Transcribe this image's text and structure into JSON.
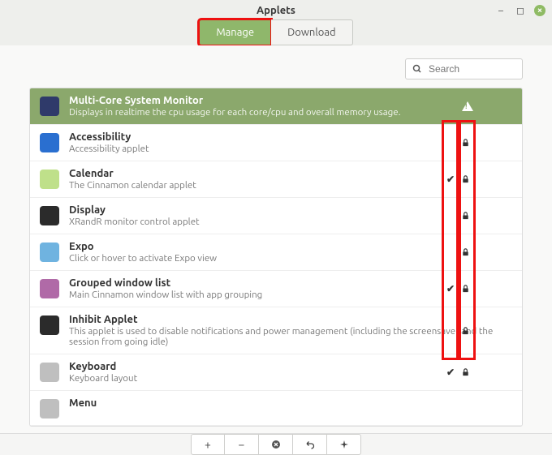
{
  "window": {
    "title": "Applets"
  },
  "tabs": {
    "manage": "Manage",
    "download": "Download"
  },
  "search": {
    "placeholder": "Search"
  },
  "applets": [
    {
      "title": "Multi-Core System Monitor",
      "sub": "Displays in realtime the cpu usage for each core/cpu and overall memory usage.",
      "selected": true,
      "alert": true,
      "icon_bg": "#2f3a6a"
    },
    {
      "title": "Accessibility",
      "sub": "Accessibility applet",
      "lock": true,
      "icon_bg": "#2a6fd0"
    },
    {
      "title": "Calendar",
      "sub": "The Cinnamon calendar applet",
      "lock": true,
      "check": true,
      "gear": "active",
      "icon_bg": "#bfe08a"
    },
    {
      "title": "Display",
      "sub": "XRandR monitor control applet",
      "lock": true,
      "icon_bg": "#2b2b2b"
    },
    {
      "title": "Expo",
      "sub": "Click or hover to activate Expo view",
      "lock": true,
      "gear": "dim",
      "icon_bg": "#6fb3e0"
    },
    {
      "title": "Grouped window list",
      "sub": "Main Cinnamon window list with app grouping",
      "lock": true,
      "check": true,
      "gear": "active",
      "icon_bg": "#b06aa7"
    },
    {
      "title": "Inhibit Applet",
      "sub": "This applet is used to disable notifications and power management (including the screensaver and the session from going idle)",
      "lock": true,
      "icon_bg": "#2b2b2b"
    },
    {
      "title": "Keyboard",
      "sub": "Keyboard layout",
      "lock": true,
      "check": true,
      "icon_bg": "#bfbfbf"
    },
    {
      "title": "Menu",
      "sub": "",
      "icon_bg": "#bfbfbf"
    }
  ],
  "toolbar": {
    "add": "+",
    "remove": "−",
    "uninstall": "✖",
    "undo": "↶",
    "refresh": "✦"
  }
}
